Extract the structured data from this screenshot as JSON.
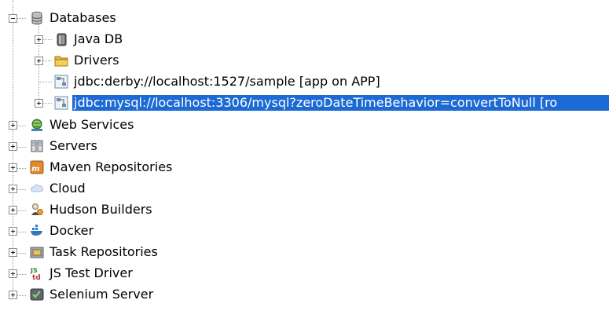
{
  "tree": {
    "databases": {
      "label": "Databases",
      "children": {
        "java_db": "Java DB",
        "drivers": "Drivers",
        "conn_derby": "jdbc:derby://localhost:1527/sample [app on APP]",
        "conn_mysql": "jdbc:mysql://localhost:3306/mysql?zeroDateTimeBehavior=convertToNull [ro"
      }
    },
    "web_services": "Web Services",
    "servers": "Servers",
    "maven_repositories": "Maven Repositories",
    "cloud": "Cloud",
    "hudson_builders": "Hudson Builders",
    "docker": "Docker",
    "task_repositories": "Task Repositories",
    "js_test_driver": "JS Test Driver",
    "selenium_server": "Selenium Server"
  },
  "colors": {
    "selection": "#1c6ad6"
  }
}
